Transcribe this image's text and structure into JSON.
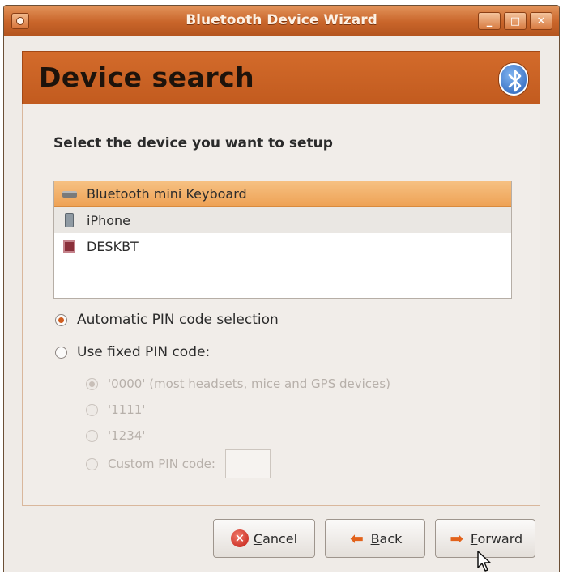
{
  "window": {
    "title": "Bluetooth Device Wizard",
    "controls": {
      "minimize": "_",
      "maximize": "□",
      "close": "✕"
    }
  },
  "banner": {
    "heading": "Device search",
    "logo_icon": "bluetooth-icon"
  },
  "prompt": "Select the device you want to setup",
  "devices": [
    {
      "name": "Bluetooth mini Keyboard",
      "icon": "keyboard-icon",
      "selected": true
    },
    {
      "name": "iPhone",
      "icon": "phone-icon",
      "selected": false
    },
    {
      "name": "DESKBT",
      "icon": "computer-icon",
      "selected": false
    }
  ],
  "pin_options": {
    "automatic": {
      "label": "Automatic PIN code selection",
      "checked": true
    },
    "fixed": {
      "label": "Use fixed PIN code:",
      "checked": false
    },
    "fixed_choices": [
      {
        "label": "'0000' (most headsets, mice and GPS devices)",
        "checked": true
      },
      {
        "label": "'1111'",
        "checked": false
      },
      {
        "label": "'1234'",
        "checked": false
      },
      {
        "label": "Custom PIN code:",
        "checked": false,
        "value": ""
      }
    ]
  },
  "buttons": {
    "cancel": {
      "mnemonic": "C",
      "rest": "ancel"
    },
    "back": {
      "mnemonic": "B",
      "rest": "ack"
    },
    "forward": {
      "mnemonic": "F",
      "rest": "orward"
    }
  },
  "colors": {
    "accent": "#c9652a",
    "selection": "#eea255",
    "bluetooth": "#2860b8"
  }
}
